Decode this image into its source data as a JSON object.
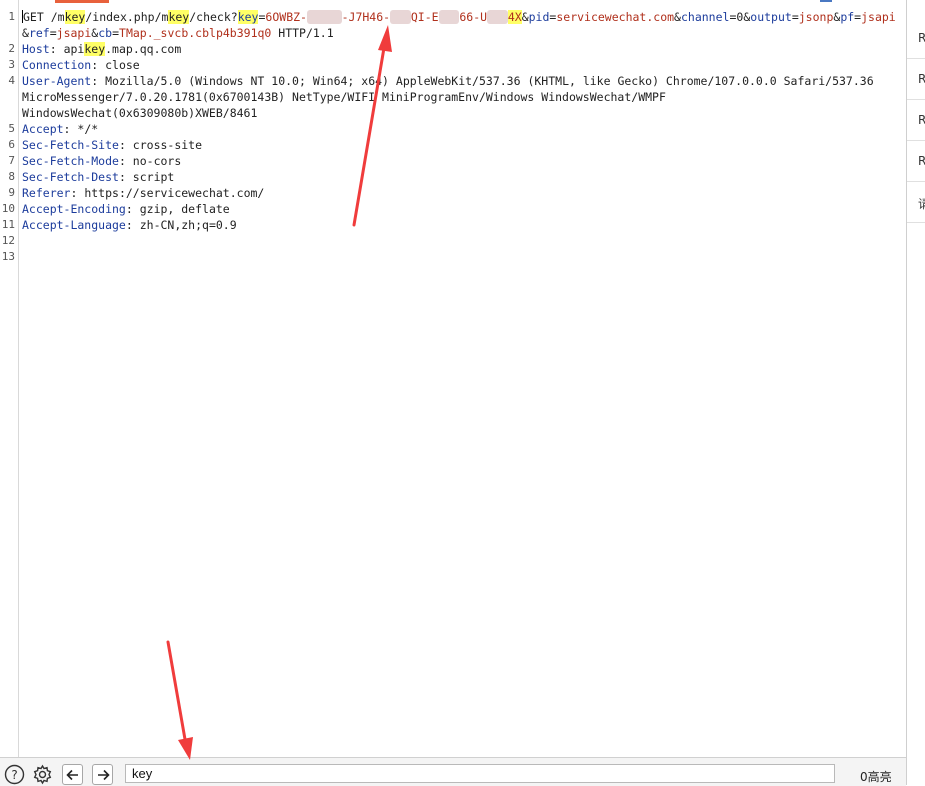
{
  "editor": {
    "line_numbers": [
      "1",
      "2",
      "3",
      "4",
      "5",
      "6",
      "7",
      "8",
      "9",
      "10",
      "11",
      "12",
      "13"
    ],
    "request_line": {
      "method": "GET",
      "path_a": " /m",
      "key_1": "key",
      "path_b": "/index.php/m",
      "key_2": "key",
      "path_c": "/check?",
      "key_3": "key",
      "eq": "=",
      "key_value_start": "6",
      "key_blur_1": "OWBZ",
      "key_value_mid1": "-",
      "key_blur_2": "xxxxx",
      "key_value_mid2": "-J7H46-",
      "key_blur_3": "xxx",
      "key_value_mid3": "QI-E",
      "key_blur_4": "xxx",
      "key_value_mid4": "66-U",
      "key_blur_5": "xxx",
      "key_value_end": "4X",
      "amp1": "&",
      "pid_key": "pid",
      "pid_val": "servicewechat.com",
      "channel_key": "channel",
      "channel_val": "0",
      "output_key": "output",
      "output_val": "jsonp",
      "pf_key": "pf",
      "pf_val": "jsapi",
      "ref_key": "ref",
      "ref_val": "jsapi",
      "cb_key": "cb",
      "cb_val": "TMap._svcb.cblp4b391q0",
      "protocol": " HTTP/1.1"
    },
    "headers": [
      {
        "name": "Host",
        "value_a": " api",
        "value_key": "key",
        "value_b": ".map.qq.com"
      },
      {
        "name": "Connection",
        "value": " close"
      },
      {
        "name": "User-Agent",
        "value": " Mozilla/5.0 (Windows NT 10.0; Win64; x64) AppleWebKit/537.36 (KHTML, like Gecko) Chrome/107.0.0.0 Safari/537.36",
        "value_cont1": "MicroMessenger/7.0.20.1781(0x6700143B) NetType/WIFI MiniProgramEnv/Windows WindowsWechat/WMPF",
        "value_cont2": "WindowsWechat(0x6309080b)XWEB/8461"
      },
      {
        "name": "Accept",
        "value": " */*"
      },
      {
        "name": "Sec-Fetch-Site",
        "value": " cross-site"
      },
      {
        "name": "Sec-Fetch-Mode",
        "value": " no-cors"
      },
      {
        "name": "Sec-Fetch-Dest",
        "value": " script"
      },
      {
        "name": "Referer",
        "value": " https://servicewechat.com/"
      },
      {
        "name": "Accept-Encoding",
        "value": " gzip, deflate"
      },
      {
        "name": "Accept-Language",
        "value": " zh-CN,zh;q=0.9"
      }
    ]
  },
  "right_panel": {
    "items": [
      "R",
      "R",
      "R",
      "R",
      "请"
    ]
  },
  "search_bar": {
    "help_icon": "help-icon",
    "settings_icon": "gear-icon",
    "prev_icon": "arrow-left-icon",
    "next_icon": "arrow-right-icon",
    "query": "key",
    "match_count": "0高亮"
  },
  "colors": {
    "header_name": "#1c3c9c",
    "param_value": "#b0301c",
    "highlight": "#ffff66",
    "annotation_arrow": "#f03c3c",
    "tab_accent": "#e8613c"
  }
}
